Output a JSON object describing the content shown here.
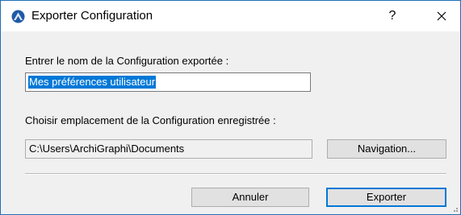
{
  "window": {
    "title": "Exporter Configuration",
    "help_label": "?",
    "icon": "archicad-app-icon"
  },
  "form": {
    "name_label": "Entrer le nom de la Configuration exportée :",
    "name_value": "Mes préférences utilisateur",
    "location_label": "Choisir emplacement de la Configuration enregistrée :",
    "location_value": "C:\\Users\\ArchiGraphi\\Documents",
    "browse_label": "Navigation..."
  },
  "actions": {
    "cancel_label": "Annuler",
    "export_label": "Exporter"
  },
  "colors": {
    "accent": "#0078d7",
    "dialog_bg": "#f0f0f0",
    "border": "#1f6fb8"
  }
}
